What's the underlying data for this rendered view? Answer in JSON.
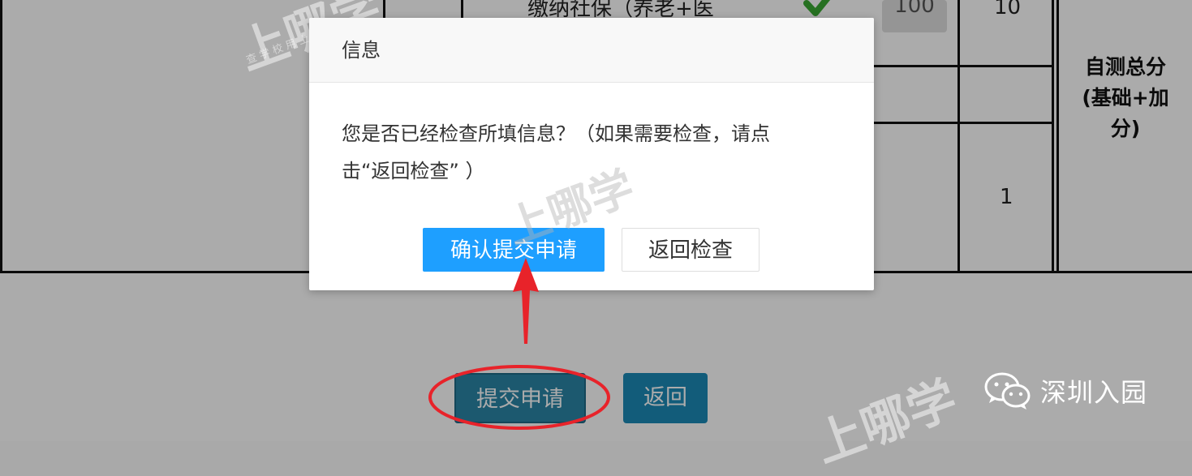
{
  "background_table": {
    "partial_item_text": "缴纳社保（养老+医",
    "score_value": "100",
    "points_value_top": "10",
    "points_value_bottom": "1",
    "summary_header_lines": [
      "自测总分",
      "(基础+加",
      "分)"
    ]
  },
  "background_buttons": {
    "submit_label": "提交申请",
    "back_label": "返回"
  },
  "wechat_account": {
    "name": "深圳入园"
  },
  "watermark": {
    "text": "上哪学",
    "sub_text": "查 学 校 用 上 哪 学"
  },
  "dialog": {
    "title": "信息",
    "message_line1": "您是否已经检查所填信息？（如果需要检查，请点",
    "message_line2": "击“返回检查” ）",
    "confirm_label": "确认提交申请",
    "cancel_label": "返回检查"
  },
  "colors": {
    "confirm_blue": "#1e9fff",
    "submit_bg": "#2b85a6",
    "annotation_red": "#e8232a",
    "check_green": "#3aa832"
  }
}
